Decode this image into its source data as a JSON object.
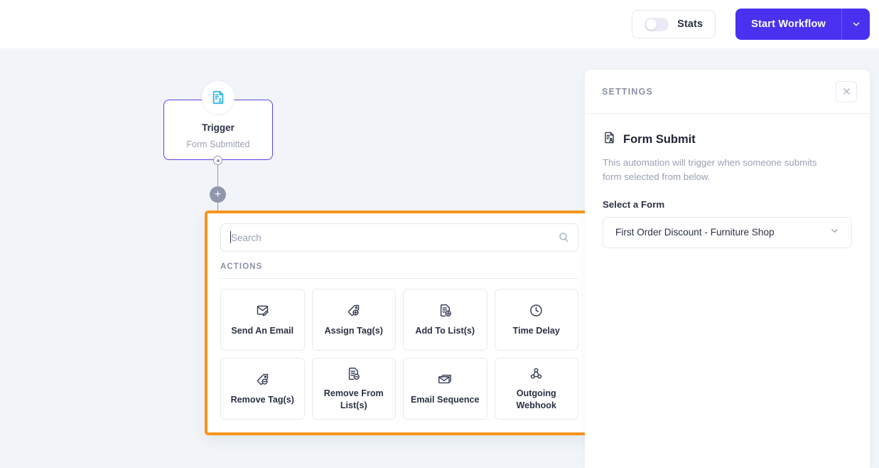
{
  "topbar": {
    "stats_label": "Stats",
    "stats_toggle_state": "off",
    "start_workflow_label": "Start Workflow",
    "dropdown_icon": "chevron-down-icon"
  },
  "canvas": {
    "trigger_node": {
      "icon": "form-submit-icon",
      "title": "Trigger",
      "subtitle": "Form Submitted"
    },
    "add_step_button": "+"
  },
  "action_picker": {
    "search": {
      "placeholder": "Search",
      "value": "",
      "icon": "search-icon"
    },
    "section_label": "ACTIONS",
    "actions": [
      {
        "label": "Send An Email",
        "icon": "envelope-edit-icon"
      },
      {
        "label": "Assign Tag(s)",
        "icon": "tag-plus-icon"
      },
      {
        "label": "Add To List(s)",
        "icon": "list-plus-icon"
      },
      {
        "label": "Time Delay",
        "icon": "clock-icon"
      },
      {
        "label": "Remove Tag(s)",
        "icon": "tag-minus-icon"
      },
      {
        "label": "Remove From List(s)",
        "icon": "list-minus-icon"
      },
      {
        "label": "Email Sequence",
        "icon": "stacked-envelope-icon"
      },
      {
        "label": "Outgoing Webhook",
        "icon": "webhook-icon"
      }
    ]
  },
  "settings": {
    "header_title": "SETTINGS",
    "close_icon": "close-icon",
    "node_icon": "form-submit-icon",
    "node_title": "Form Submit",
    "description": "This automation will trigger when someone submits form selected from below.",
    "field_label": "Select a Form",
    "select_value": "First Order Discount - Furniture Shop",
    "select_icon": "chevron-down-icon"
  },
  "colors": {
    "accent": "#4a31f0",
    "highlight_border": "#f7941e",
    "trigger_border": "#5b3ff0",
    "trigger_icon": "#22b6f0",
    "canvas_bg": "#f1f5f9"
  }
}
